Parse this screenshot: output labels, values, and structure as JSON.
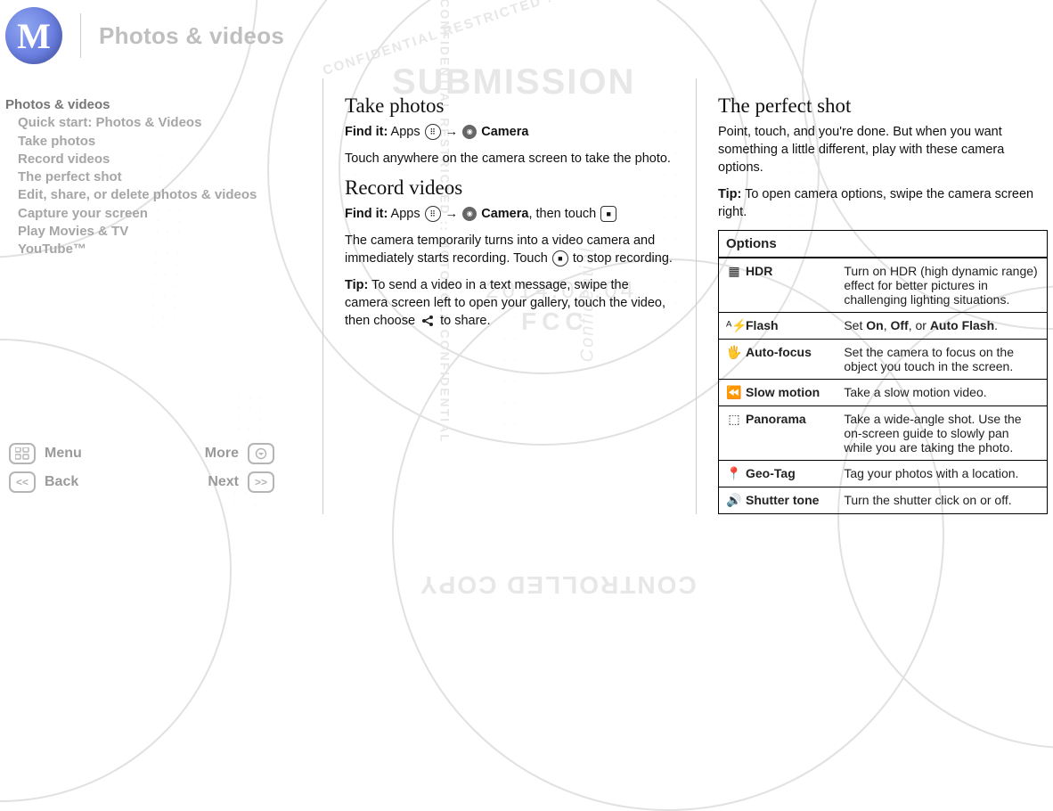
{
  "header": {
    "logo_letter": "M",
    "title": "Photos & videos"
  },
  "watermark": {
    "submission": "SUBMISSION",
    "date": "2014.02.04",
    "agency": "FCC",
    "ring": "CONFIDENTIAL RESTRICTED :: MOTOROLA CONFIDENTIAL",
    "controlled": "CONTROLLED COPY",
    "confidential_v": "Confidential"
  },
  "toc": {
    "items": [
      {
        "label": "Photos & videos",
        "level": 0,
        "active": true
      },
      {
        "label": "Quick start: Photos & Videos",
        "level": 1,
        "active": false
      },
      {
        "label": "Take photos",
        "level": 1,
        "active": false
      },
      {
        "label": "Record videos",
        "level": 1,
        "active": false
      },
      {
        "label": "The perfect shot",
        "level": 1,
        "active": false
      },
      {
        "label": "Edit, share, or delete photos & videos",
        "level": 1,
        "active": false
      },
      {
        "label": "Capture your screen",
        "level": 1,
        "active": false
      },
      {
        "label": "Play Movies & TV",
        "level": 1,
        "active": false
      },
      {
        "label": "YouTube™",
        "level": 1,
        "active": false
      }
    ]
  },
  "nav": {
    "menu": "Menu",
    "more": "More",
    "back": "Back",
    "next": "Next"
  },
  "col1": {
    "take_h": "Take photos",
    "take_find_label": "Find it:",
    "take_find_a": " Apps ",
    "take_find_b": " → ",
    "take_find_c": " Camera",
    "take_p1": "Touch anywhere on the camera screen to take the photo.",
    "rec_h": "Record videos",
    "rec_find_label": "Find it:",
    "rec_find_a": " Apps ",
    "rec_find_b": " → ",
    "rec_find_c": " Camera",
    "rec_find_d": ", then touch ",
    "rec_p1a": "The camera temporarily turns into a video camera and immediately starts recording. Touch ",
    "rec_p1b": " to stop recording.",
    "rec_tip_label": "Tip:",
    "rec_tip_a": " To send a video in a text message, swipe the camera screen left to open your gallery, touch the video, then choose ",
    "rec_tip_b": " to share."
  },
  "col2": {
    "h": "The perfect shot",
    "p1": "Point, touch, and you're done. But when you want something a little different, play with these camera options.",
    "tip_label": "Tip:",
    "tip_text": " To open camera options, swipe the camera screen right.",
    "table_header": "Options",
    "rows": [
      {
        "icon": "HDR",
        "icon_glyph": "▦",
        "name": "HDR",
        "desc": "Turn on HDR (high dynamic range) effect for better pictures in challenging lighting situations."
      },
      {
        "icon": "flash",
        "icon_glyph": "ᴬ⚡",
        "name": "Flash",
        "desc_pre": "Set ",
        "b1": "On",
        "m1": ", ",
        "b2": "Off",
        "m2": ", or ",
        "b3": "Auto Flash",
        "m3": "."
      },
      {
        "icon": "focus",
        "icon_glyph": "🖐",
        "name": "Auto-focus",
        "desc": "Set the camera to focus on the object you touch in the screen."
      },
      {
        "icon": "slow",
        "icon_glyph": "⏪",
        "name": "Slow motion",
        "desc": "Take a slow motion video."
      },
      {
        "icon": "pano",
        "icon_glyph": "⬚",
        "name": "Panorama",
        "desc": "Take a wide-angle shot. Use the on-screen guide to slowly pan while you are taking the photo."
      },
      {
        "icon": "geo",
        "icon_glyph": "📍",
        "name": "Geo-Tag",
        "desc": "Tag your photos with a location."
      },
      {
        "icon": "shutter",
        "icon_glyph": "🔊",
        "name": "Shutter tone",
        "desc": "Turn the shutter click on or off."
      }
    ]
  }
}
